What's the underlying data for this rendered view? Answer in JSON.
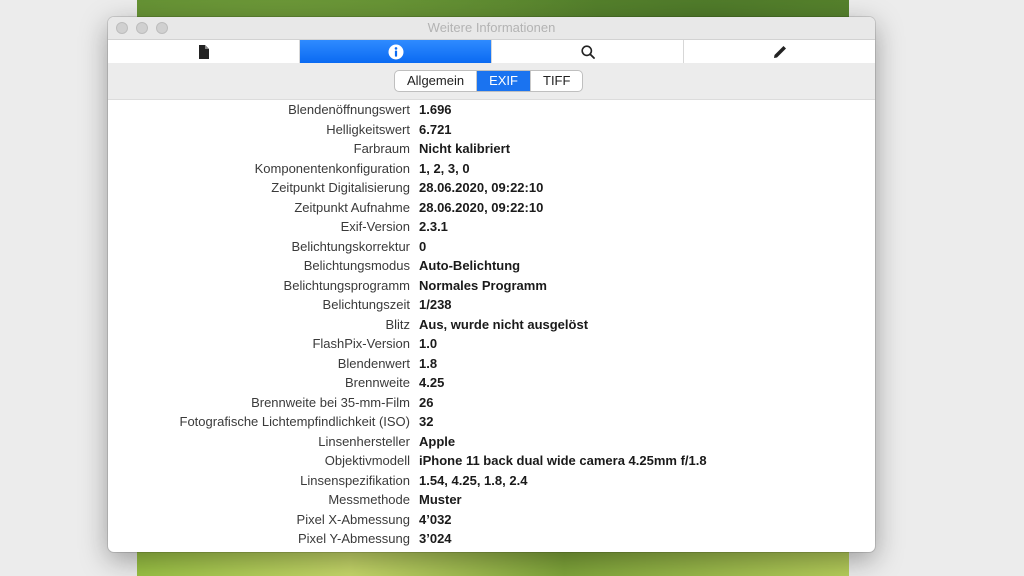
{
  "window": {
    "title": "Weitere Informationen"
  },
  "toolbar": {
    "tabs": [
      {
        "icon": "document-icon"
      },
      {
        "icon": "info-icon"
      },
      {
        "icon": "search-icon"
      },
      {
        "icon": "pencil-icon"
      }
    ],
    "active_index": 1,
    "accent_color": "#0a6af2"
  },
  "segments": {
    "items": [
      "Allgemein",
      "EXIF",
      "TIFF"
    ],
    "selected": "EXIF"
  },
  "exif": [
    {
      "key": "Blendenöffnungswert",
      "value": "1.696"
    },
    {
      "key": "Helligkeitswert",
      "value": "6.721"
    },
    {
      "key": "Farbraum",
      "value": "Nicht kalibriert"
    },
    {
      "key": "Komponentenkonfiguration",
      "value": "1, 2, 3, 0"
    },
    {
      "key": "Zeitpunkt Digitalisierung",
      "value": "28.06.2020, 09:22:10"
    },
    {
      "key": "Zeitpunkt Aufnahme",
      "value": "28.06.2020, 09:22:10"
    },
    {
      "key": "Exif-Version",
      "value": "2.3.1"
    },
    {
      "key": "Belichtungskorrektur",
      "value": "0"
    },
    {
      "key": "Belichtungsmodus",
      "value": "Auto-Belichtung"
    },
    {
      "key": "Belichtungsprogramm",
      "value": "Normales Programm"
    },
    {
      "key": "Belichtungszeit",
      "value": "1/238"
    },
    {
      "key": "Blitz",
      "value": "Aus, wurde nicht ausgelöst"
    },
    {
      "key": "FlashPix-Version",
      "value": "1.0"
    },
    {
      "key": "Blendenwert",
      "value": "1.8"
    },
    {
      "key": "Brennweite",
      "value": "4.25"
    },
    {
      "key": "Brennweite bei 35-mm-Film",
      "value": "26"
    },
    {
      "key": "Fotografische Lichtempfindlichkeit (ISO)",
      "value": "32"
    },
    {
      "key": "Linsenhersteller",
      "value": "Apple"
    },
    {
      "key": "Objektivmodell",
      "value": "iPhone 11 back dual wide camera 4.25mm f/1.8"
    },
    {
      "key": "Linsenspezifikation",
      "value": "1.54, 4.25, 1.8, 2.4"
    },
    {
      "key": "Messmethode",
      "value": "Muster"
    },
    {
      "key": "Pixel X-Abmessung",
      "value": "4’032"
    },
    {
      "key": "Pixel Y-Abmessung",
      "value": "3’024"
    }
  ]
}
